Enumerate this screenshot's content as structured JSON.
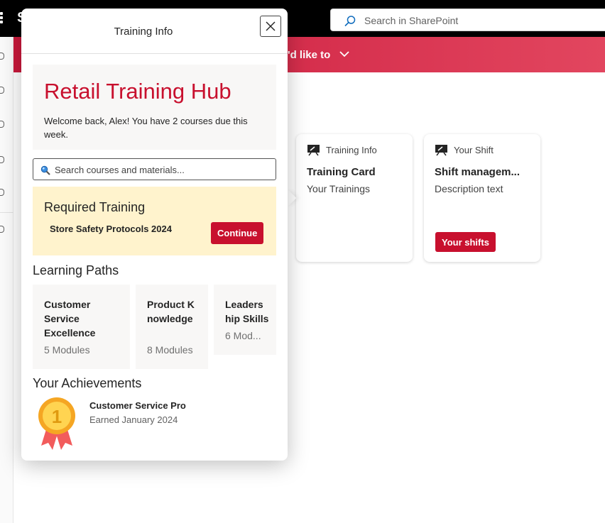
{
  "topbar": {
    "brand_initial": "S",
    "search_placeholder": "Search in SharePoint"
  },
  "hub": {
    "nav_text": "'d like to"
  },
  "cards": [
    {
      "header": "Training Info",
      "title": "Training Card",
      "description": "Your Trainings",
      "button": ""
    },
    {
      "header": "Your Shift",
      "title": "Shift managem...",
      "description": "Description text",
      "button": "Your shifts"
    }
  ],
  "dialog": {
    "title": "Training Info",
    "welcome": {
      "heading": "Retail Training Hub",
      "message": "Welcome back, Alex! You have 2 courses due this week."
    },
    "search_placeholder": "Search courses and materials...",
    "required": {
      "heading": "Required Training",
      "course": "Store Safety Protocols 2024",
      "button": "Continue"
    },
    "learning_paths_heading": "Learning Paths",
    "learning_paths": [
      {
        "name": "Customer Service Excellence",
        "modules": "5 Modules"
      },
      {
        "name": "Product Knowledge",
        "modules": "8 Modules"
      },
      {
        "name": "Leadership Skills",
        "modules": "6 Mod..."
      }
    ],
    "achievements_heading": "Your Achievements",
    "achievement": {
      "medal_number": "1",
      "name": "Customer Service Pro",
      "earned": "Earned January 2024"
    }
  },
  "colors": {
    "brand_red": "#c8102e",
    "required_bg": "#fff3cd",
    "panel_bg": "#f8f7f6"
  }
}
